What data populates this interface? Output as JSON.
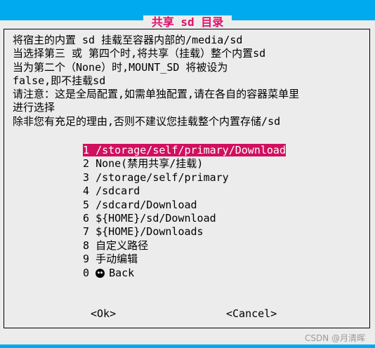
{
  "dialog": {
    "title": "共享 sd 目录",
    "description": "将宿主的内置 sd 挂载至容器内部的/media/sd\n当选择第三 或 第四个时,将共享（挂载）整个内置sd\n当为第二个（None）时,MOUNT_SD 将被设为\nfalse,即不挂载sd\n请注意：这是全局配置,如需单独配置,请在各自的容器菜单里\n进行选择\n除非您有充足的理由,否则不建议您挂载整个内置存储/sd"
  },
  "menu": {
    "items": [
      {
        "key": "1",
        "label": "/storage/self/primary/Download",
        "selected": true
      },
      {
        "key": "2",
        "label": "None(禁用共享/挂载)"
      },
      {
        "key": "3",
        "label": "/storage/self/primary"
      },
      {
        "key": "4",
        "label": "/sdcard"
      },
      {
        "key": "5",
        "label": "/sdcard/Download"
      },
      {
        "key": "6",
        "label": "${HOME}/sd/Download"
      },
      {
        "key": "7",
        "label": "${HOME}/Downloads"
      },
      {
        "key": "8",
        "label": "自定义路径"
      },
      {
        "key": "9",
        "label": "手动编辑"
      },
      {
        "key": "0",
        "label": "Back",
        "icon": "skull-icon"
      }
    ]
  },
  "buttons": {
    "ok": "<Ok>",
    "cancel": "<Cancel>"
  },
  "watermark": "CSDN @月清晖",
  "colors": {
    "background": "#00aaee",
    "dialog": "#ececec",
    "accent": "#d0105f"
  }
}
